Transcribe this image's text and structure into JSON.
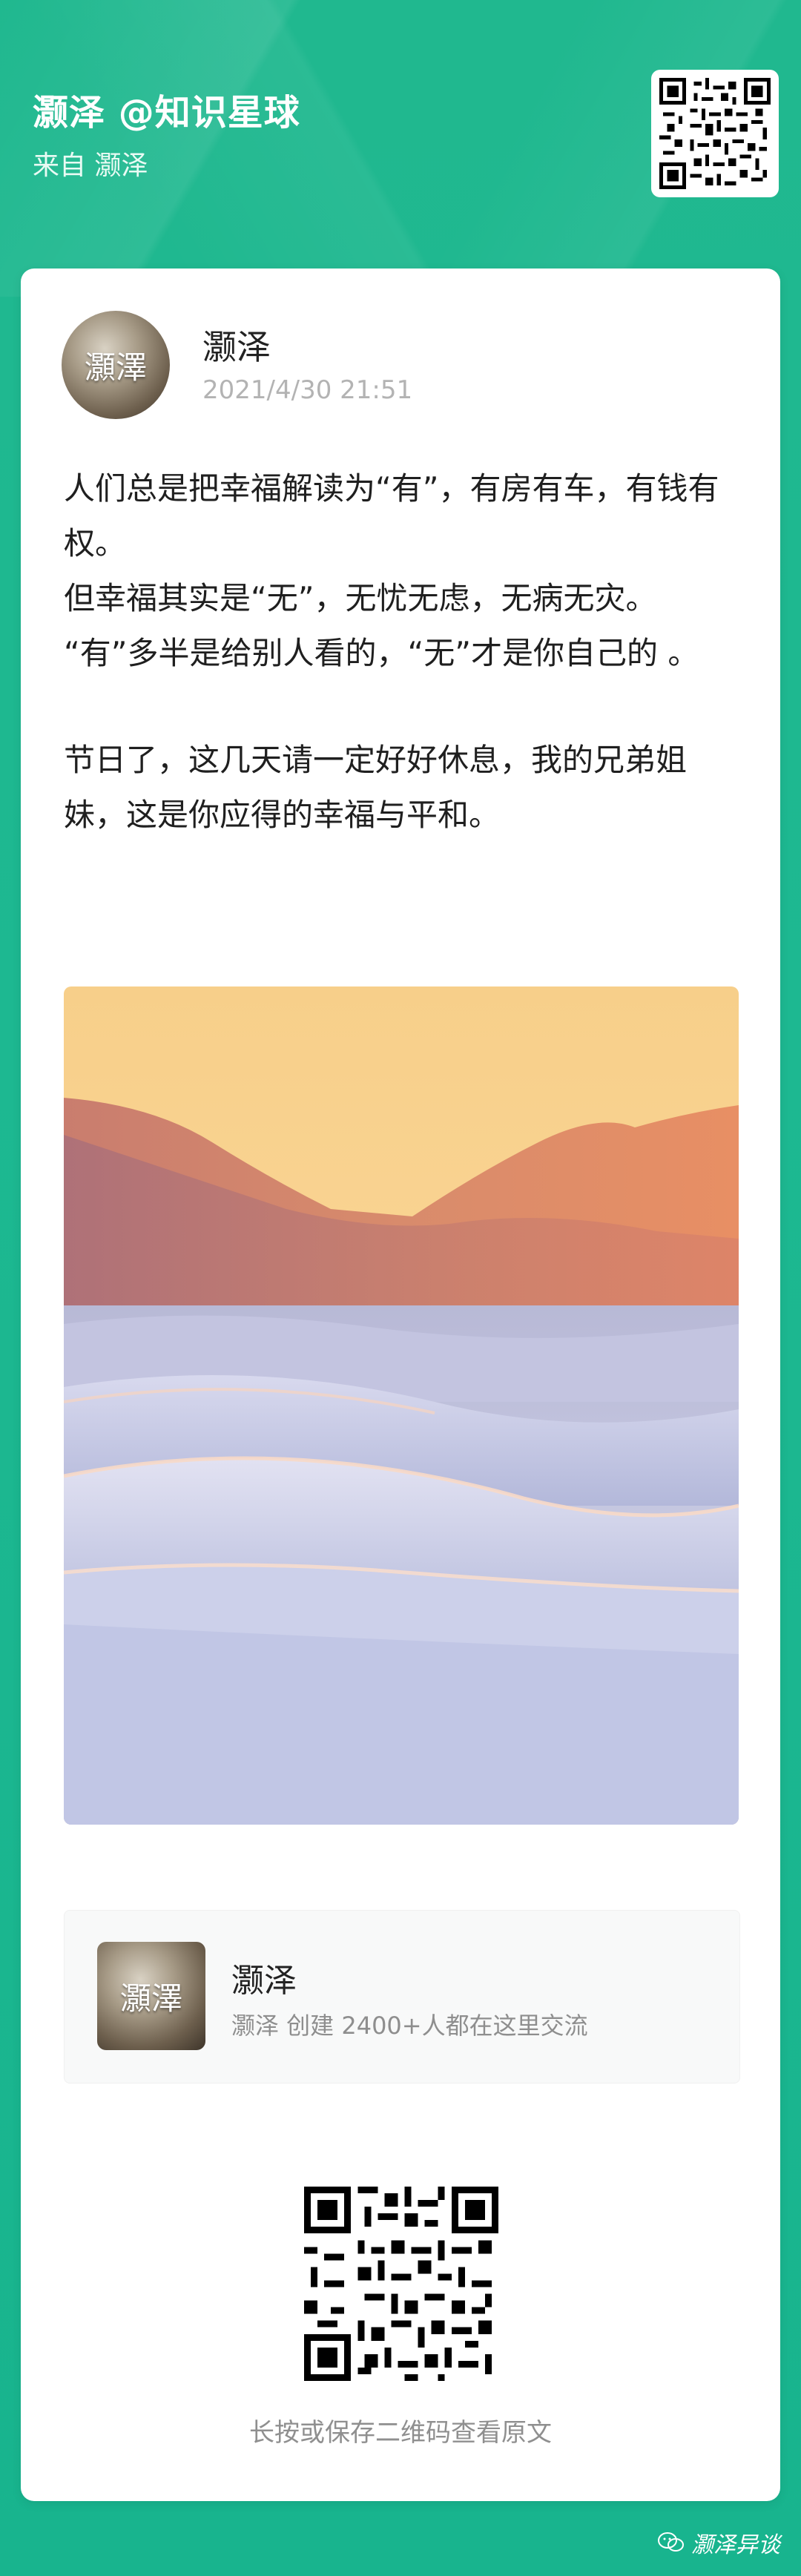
{
  "header": {
    "title": "灏泽 @知识星球",
    "subtitle": "来自 灏泽"
  },
  "post": {
    "avatar_text": "灝澤",
    "author": "灏泽",
    "time": "2021/4/30 21:51",
    "paragraphs": [
      "人们总是把幸福解读为“有”，有房有车，有钱有权。",
      "但幸福其实是“无”，无忧无虑，无病无灾。",
      "“有”多半是给别人看的，“无”才是你自己的 。",
      "节日了，这几天请一定好好休息，我的兄弟姐妹，这是你应得的幸福与平和。"
    ]
  },
  "group": {
    "avatar_text": "灝澤",
    "name": "灏泽",
    "info": "灏泽 创建  2400+人都在这里交流"
  },
  "footer": {
    "caption": "长按或保存二维码查看原文",
    "watermark": "灏泽异谈"
  },
  "colors": {
    "background": "#1fb58f",
    "card": "#ffffff",
    "text": "#1f1f1f",
    "muted": "#8f8f8f"
  },
  "icons": [
    "qr-code-icon",
    "wechat-icon"
  ]
}
